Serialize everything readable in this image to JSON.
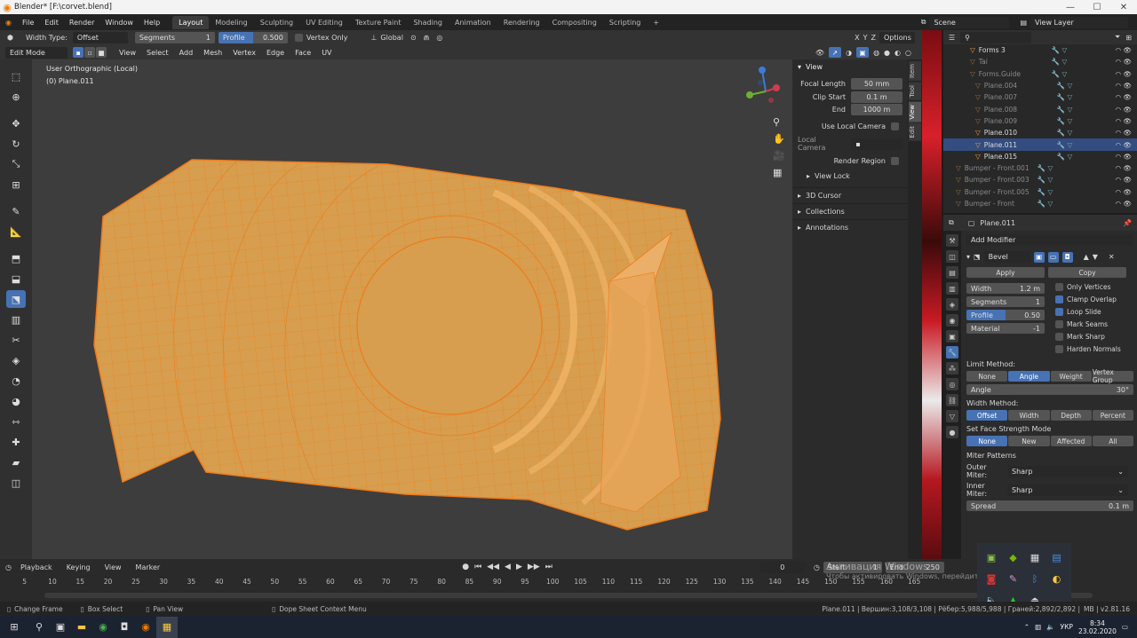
{
  "window": {
    "title": "Blender* [F:\\corvet.blend]"
  },
  "menu": [
    "File",
    "Edit",
    "Render",
    "Window",
    "Help"
  ],
  "workspaces": [
    "Layout",
    "Modeling",
    "Sculpting",
    "UV Editing",
    "Texture Paint",
    "Shading",
    "Animation",
    "Rendering",
    "Compositing",
    "Scripting"
  ],
  "active_workspace": "Layout",
  "scene": {
    "scene_name": "Scene",
    "view_layer": "View Layer"
  },
  "tool_settings": {
    "width_type_label": "Width Type:",
    "width_type_value": "Offset",
    "segments_label": "Segments",
    "segments_value": "1",
    "profile_label": "Profile",
    "profile_value": "0.500",
    "vertex_only": "Vertex Only",
    "orientation": "Global",
    "options": "Options"
  },
  "viewport_header": {
    "mode": "Edit Mode",
    "menus": [
      "View",
      "Select",
      "Add",
      "Mesh",
      "Vertex",
      "Edge",
      "Face",
      "UV"
    ]
  },
  "viewport": {
    "view_name": "User Orthographic (Local)",
    "object_info": "(0) Plane.011"
  },
  "npanel": {
    "view_header": "View",
    "focal_length_label": "Focal Length",
    "focal_length": "50 mm",
    "clip_start_label": "Clip Start",
    "clip_start": "0.1 m",
    "end_label": "End",
    "end": "1000 m",
    "use_local_camera": "Use Local Camera",
    "local_camera_label": "Local Camera",
    "render_region": "Render Region",
    "view_lock": "View Lock",
    "cursor_3d": "3D Cursor",
    "collections": "Collections",
    "annotations": "Annotations",
    "tabs": [
      "Item",
      "Tool",
      "View",
      "Edit"
    ]
  },
  "outliner": {
    "items": [
      {
        "name": "Forms 3",
        "style": "normal"
      },
      {
        "name": "Tai",
        "style": "dim"
      },
      {
        "name": "Forms.Guide",
        "style": "dim"
      },
      {
        "name": "Plane.004",
        "style": "dim"
      },
      {
        "name": "Plane.007",
        "style": "dim"
      },
      {
        "name": "Plane.008",
        "style": "dim"
      },
      {
        "name": "Plane.009",
        "style": "dim"
      },
      {
        "name": "Plane.010",
        "style": "normal"
      },
      {
        "name": "Plane.011",
        "style": "selected"
      },
      {
        "name": "Plane.015",
        "style": "normal"
      },
      {
        "name": "Bumper - Front.001",
        "style": "dim"
      },
      {
        "name": "Bumper - Front.003",
        "style": "dim"
      },
      {
        "name": "Bumper - Front.005",
        "style": "dim"
      },
      {
        "name": "Bumper - Front",
        "style": "dim"
      }
    ]
  },
  "properties": {
    "object_name": "Plane.011",
    "add_modifier": "Add Modifier",
    "modifier_name": "Bevel",
    "apply": "Apply",
    "copy": "Copy",
    "width_label": "Width",
    "width": "1.2 m",
    "segments_label": "Segments",
    "segments": "1",
    "profile_label": "Profile",
    "profile": "0.50",
    "material_label": "Material",
    "material": "-1",
    "only_vertices": "Only Vertices",
    "clamp_overlap": "Clamp Overlap",
    "loop_slide": "Loop Slide",
    "mark_seams": "Mark Seams",
    "mark_sharp": "Mark Sharp",
    "harden_normals": "Harden Normals",
    "limit_method_label": "Limit Method:",
    "limit_methods": [
      "None",
      "Angle",
      "Weight",
      "Vertex Group"
    ],
    "limit_method_active": "Angle",
    "angle_label": "Angle",
    "angle": "30°",
    "width_method_label": "Width Method:",
    "width_methods": [
      "Offset",
      "Width",
      "Depth",
      "Percent"
    ],
    "width_method_active": "Offset",
    "face_strength_label": "Set Face Strength Mode",
    "face_strength": [
      "None",
      "New",
      "Affected",
      "All"
    ],
    "face_strength_active": "None",
    "miter_patterns": "Miter Patterns",
    "outer_miter_label": "Outer Miter:",
    "outer_miter": "Sharp",
    "inner_miter_label": "Inner Miter:",
    "inner_miter": "Sharp",
    "spread_label": "Spread",
    "spread": "0.1 m"
  },
  "timeline": {
    "menus": [
      "Playback",
      "Keying",
      "View",
      "Marker"
    ],
    "current_frame": "0",
    "start_label": "Start",
    "start": "1",
    "end_label": "End",
    "end": "250",
    "ticks": [
      "5",
      "10",
      "15",
      "20",
      "25",
      "30",
      "35",
      "40",
      "45",
      "50",
      "55",
      "60",
      "65",
      "70",
      "75",
      "80",
      "85",
      "90",
      "95",
      "100",
      "105",
      "110",
      "115",
      "120",
      "125",
      "130",
      "135",
      "140",
      "145",
      "150",
      "155",
      "160",
      "165"
    ]
  },
  "watermark": {
    "line1": "Активация Windows",
    "line2": "Чтобы активировать Windows, перейдите в раздел \"Параметры\"."
  },
  "statusbar": {
    "change_frame": "Change Frame",
    "box_select": "Box Select",
    "pan_view": "Pan View",
    "context_menu": "Dope Sheet Context Menu",
    "stats": "Plane.011 | Вершин:3,108/3,108 | Рёбер:5,988/5,988 | Граней:2,892/2,892 |",
    "version": "MB | v2.81.16"
  },
  "taskbar": {
    "lang": "УКР",
    "time": "8:34",
    "date": "23.02.2020"
  },
  "colors": {
    "accent": "#4772b3",
    "mesh_fill": "#d69e4e",
    "mesh_wire": "#f07a1a",
    "vertex": "#ff7f00"
  }
}
